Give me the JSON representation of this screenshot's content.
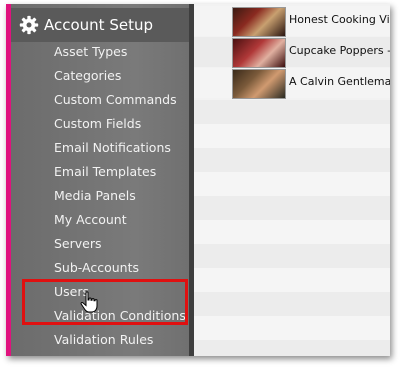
{
  "sidebar": {
    "header_label": "Account Setup",
    "items": [
      {
        "label": "Asset Types"
      },
      {
        "label": "Categories"
      },
      {
        "label": "Custom Commands"
      },
      {
        "label": "Custom Fields"
      },
      {
        "label": "Email Notifications"
      },
      {
        "label": "Email Templates"
      },
      {
        "label": "Media Panels"
      },
      {
        "label": "My Account"
      },
      {
        "label": "Servers"
      },
      {
        "label": "Sub-Accounts"
      },
      {
        "label": "Users"
      },
      {
        "label": "Validation Conditions"
      },
      {
        "label": "Validation Rules"
      }
    ]
  },
  "media_list": {
    "rows": [
      {
        "title": "Honest Cooking Visi"
      },
      {
        "title": "Cupcake Poppers - E"
      },
      {
        "title": "A Calvin Gentleman"
      }
    ]
  },
  "icons": {
    "header": "gear-icon",
    "pointer": "hand-cursor-icon"
  },
  "colors": {
    "accent_bar": "#e0137e",
    "highlight": "#e01010",
    "sidebar": "#777777"
  }
}
